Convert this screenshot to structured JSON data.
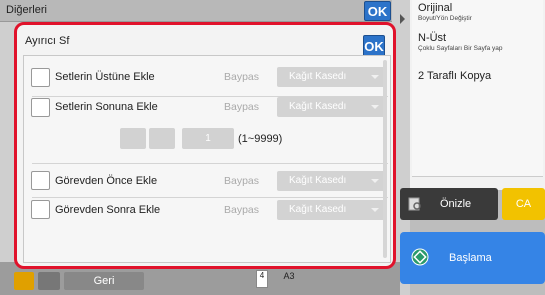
{
  "header": {
    "title": "Diğerleri",
    "ok_label": "OK"
  },
  "right_panel": {
    "items": [
      {
        "label": "Orijinal",
        "sub": "Boyut/Yön Değiştir"
      },
      {
        "label": "N-Üst",
        "sub": "Çoklu Sayfaları Bir Sayfa yap"
      },
      {
        "label": "2 Taraflı Kopya",
        "sub": ""
      }
    ]
  },
  "actions": {
    "preview_label": "Önizle",
    "ca_label": "CA",
    "start_label": "Başlama"
  },
  "bottom": {
    "back_label": "Geri",
    "paper_label": "A3",
    "paper_num": "4"
  },
  "dialog": {
    "title": "Ayırıcı Sf",
    "ok_label": "OK",
    "rows": [
      {
        "label": "Setlerin Üstüne Ekle",
        "bypass": "Baypas",
        "tray": "Kağıt Kasedı"
      },
      {
        "label": "Setlerin Sonuna Ekle",
        "bypass": "Baypas",
        "tray": "Kağıt Kasedı"
      },
      {
        "label": "Görevden Önce Ekle",
        "bypass": "Baypas",
        "tray": "Kağıt Kasedı"
      },
      {
        "label": "Görevden Sonra Ekle",
        "bypass": "Baypas",
        "tray": "Kağıt Kasedı"
      }
    ],
    "count": {
      "value": "1",
      "range": "(1~9999)"
    }
  }
}
